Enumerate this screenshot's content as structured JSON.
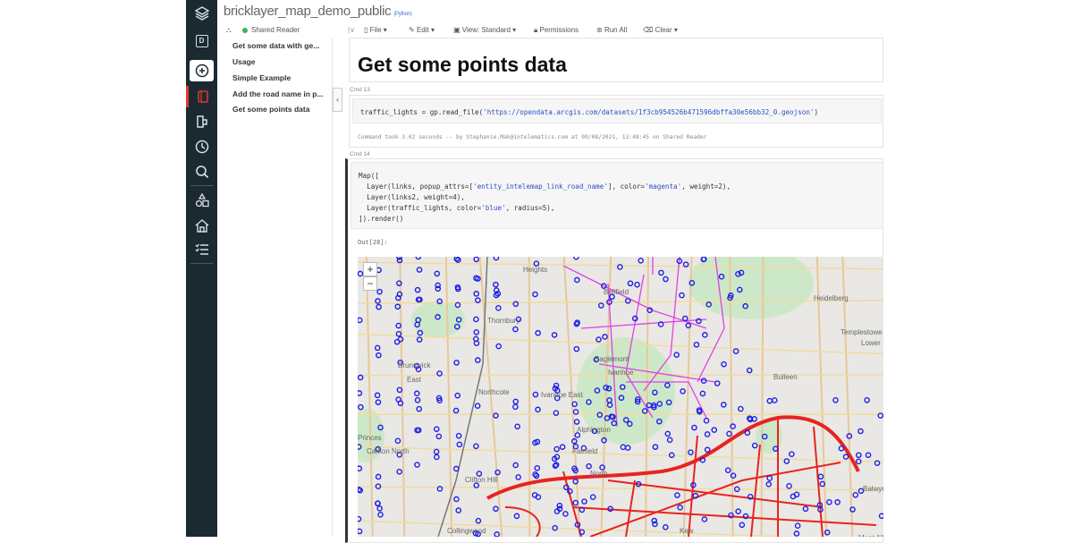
{
  "notebook": {
    "title": "bricklayer_map_demo_public",
    "language": "(Python)"
  },
  "toolbar": {
    "cluster": "Shared Reader",
    "file": "File ▾",
    "edit": "Edit ▾",
    "view": "View: Standard ▾",
    "permissions": "Permissions",
    "run_all": "Run All",
    "clear": "Clear ▾"
  },
  "rail": {
    "workspace_letter": "D"
  },
  "toc": {
    "items": [
      "Get some data with ge...",
      "Usage",
      "Simple Example",
      "Add the road name in p...",
      "Get some points data"
    ],
    "collapse": "‹"
  },
  "cells": {
    "heading": "Get some points data",
    "cmd13": {
      "label": "Cmd 13",
      "code": [
        [
          "traffic_lights = gp.read_file(",
          ""
        ],
        [
          "'https://opendata.arcgis.com/datasets/1f3cb954526b471596dbffa30e56bb32_0.geojson'",
          "s"
        ],
        [
          ")",
          ""
        ]
      ],
      "status": "Command took 3.02 seconds -- by Stephanie.Mak@intelematics.com at 09/08/2021, 13:48:45 on Shared Reader"
    },
    "cmd14": {
      "label": "Cmd 14",
      "lines": [
        [
          [
            "Map([",
            ""
          ]
        ],
        [
          [
            "  Layer(links, popup_attrs=[",
            ""
          ],
          [
            "'entity_intelemap_link_road_name'",
            "s"
          ],
          [
            "], color=",
            ""
          ],
          [
            "'magenta'",
            "s"
          ],
          [
            ", weight=2),",
            ""
          ]
        ],
        [
          [
            "  Layer(links2, weight=4),",
            ""
          ]
        ],
        [
          [
            "  Layer(traffic_lights, color=",
            ""
          ],
          [
            "'blue'",
            "s"
          ],
          [
            ", radius=5),",
            ""
          ]
        ],
        [
          [
            "]).render()",
            ""
          ]
        ]
      ],
      "out": "Out[28]:"
    }
  },
  "map": {
    "zoom_in": "+",
    "zoom_out": "−",
    "labels": [
      "Heidelberg",
      "Bellfield",
      "Thornbury",
      "Templestowe",
      "Lower",
      "Eaglemont",
      "Bulleen",
      "Brunswick",
      "East",
      "Northcote",
      "Ivanhoe East",
      "Alphington",
      "Princes",
      "Carlton North",
      "Fairfield",
      "Clifton Hill",
      "Balwyn North",
      "Collingwood",
      "Kew",
      "North",
      "Mont Albert",
      "Heights",
      "Ivanhoe"
    ],
    "colors": {
      "points": "#1f1fe8",
      "magenta_layer": "#e040e8",
      "links2_layer": "#e8231f"
    }
  }
}
